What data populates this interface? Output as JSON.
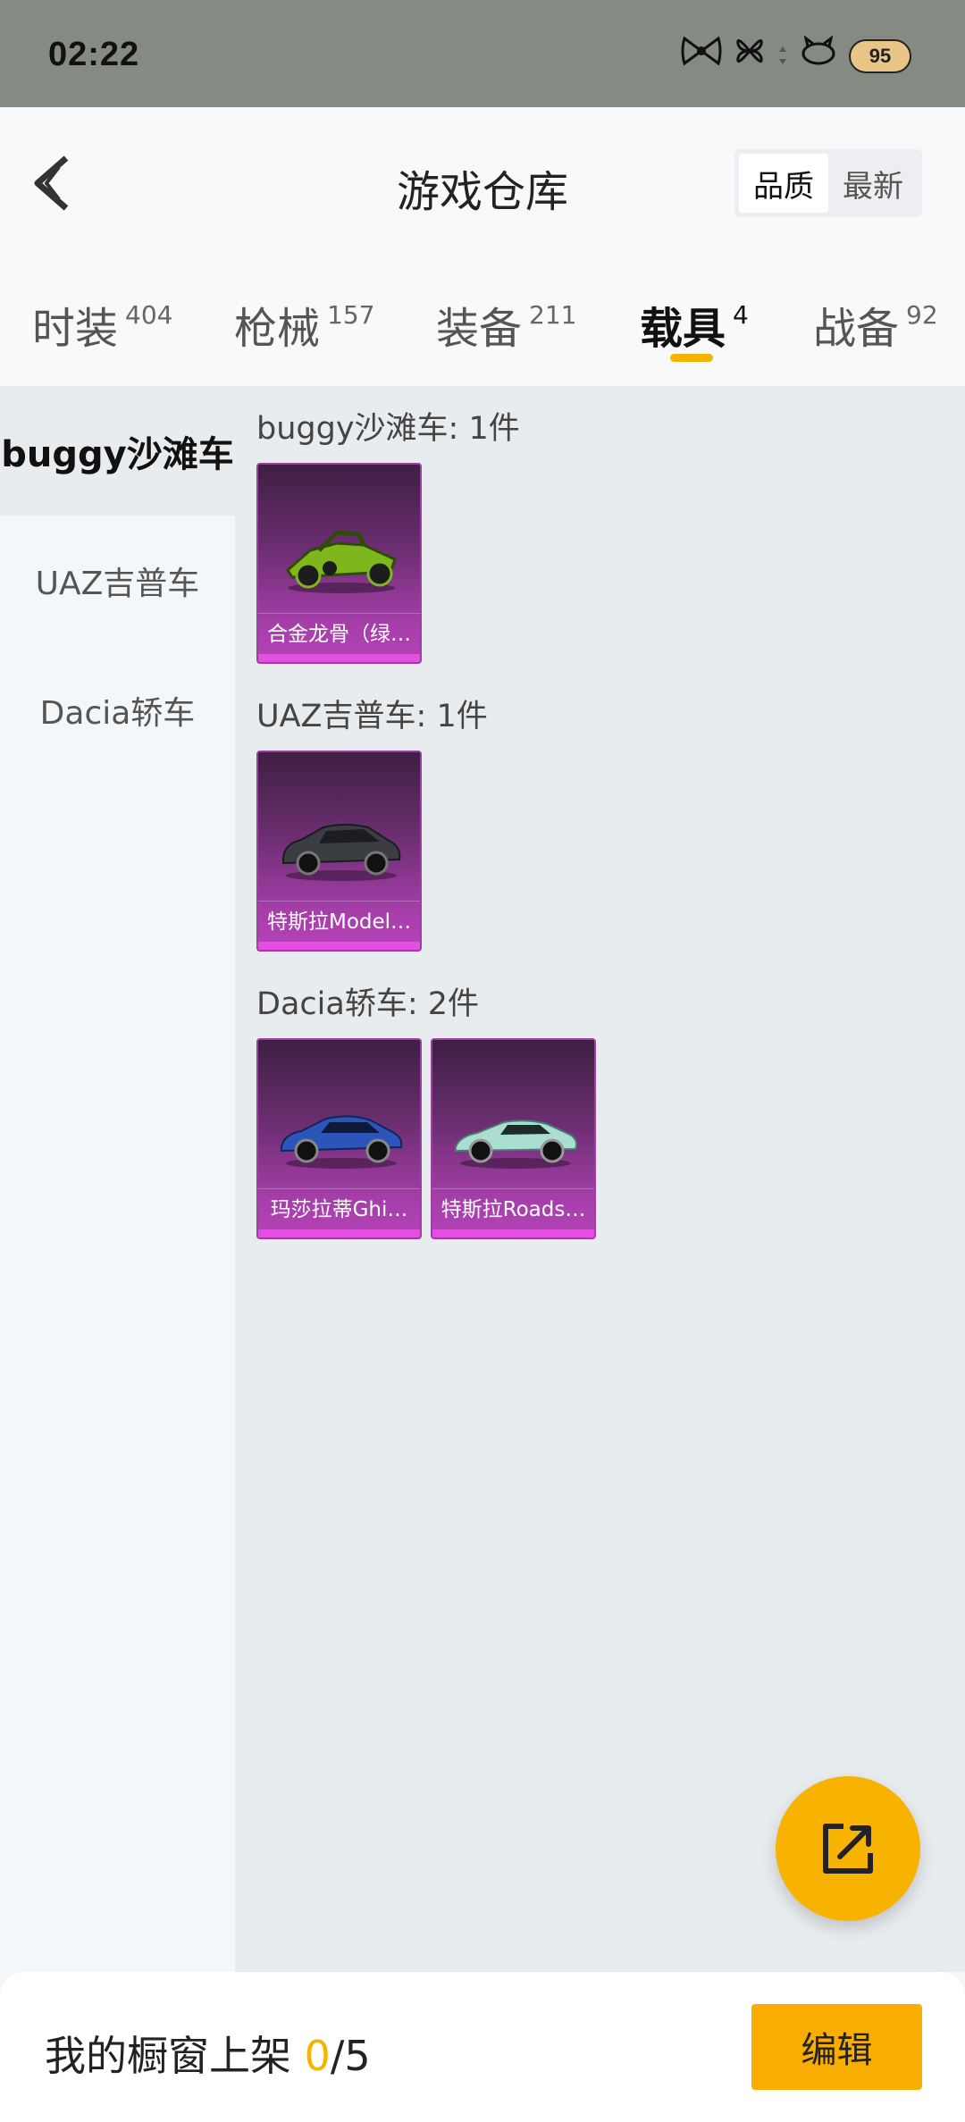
{
  "status_bar": {
    "time": "02:22",
    "battery": "95",
    "icons": [
      "bow-icon",
      "butterfly-icon",
      "signal-icon",
      "cat-icon"
    ]
  },
  "header": {
    "title": "游戏仓库",
    "sort_options": [
      "品质",
      "最新"
    ],
    "sort_selected": "品质"
  },
  "tabs": [
    {
      "label": "时装",
      "count": "404"
    },
    {
      "label": "枪械",
      "count": "157"
    },
    {
      "label": "装备",
      "count": "211"
    },
    {
      "label": "载具",
      "count": "4",
      "active": true
    },
    {
      "label": "战备",
      "count": "92"
    }
  ],
  "sidebar": {
    "items": [
      {
        "label": "buggy沙滩车",
        "active": true
      },
      {
        "label": "UAZ吉普车"
      },
      {
        "label": "Dacia轿车"
      }
    ]
  },
  "groups": [
    {
      "title": "buggy沙滩车: 1件",
      "items": [
        {
          "name": "合金龙骨（绿…",
          "icon": "buggy-car-icon",
          "color": "#7fb61c"
        }
      ]
    },
    {
      "title": "UAZ吉普车: 1件",
      "items": [
        {
          "name": "特斯拉Model…",
          "icon": "suv-car-icon",
          "color": "#3a3d42"
        }
      ]
    },
    {
      "title": "Dacia轿车: 2件",
      "items": [
        {
          "name": "玛莎拉蒂Ghi…",
          "icon": "sedan-car-icon",
          "color": "#2b55b8"
        },
        {
          "name": "特斯拉Roads…",
          "icon": "roadster-car-icon",
          "color": "#a9ded1"
        }
      ]
    }
  ],
  "bottom_bar": {
    "showcase_label": "我的橱窗上架",
    "showcase_current": "0",
    "showcase_total": "/5",
    "edit_label": "编辑"
  },
  "colors": {
    "accent": "#f8b300",
    "card_purple": "#a53ea9"
  }
}
